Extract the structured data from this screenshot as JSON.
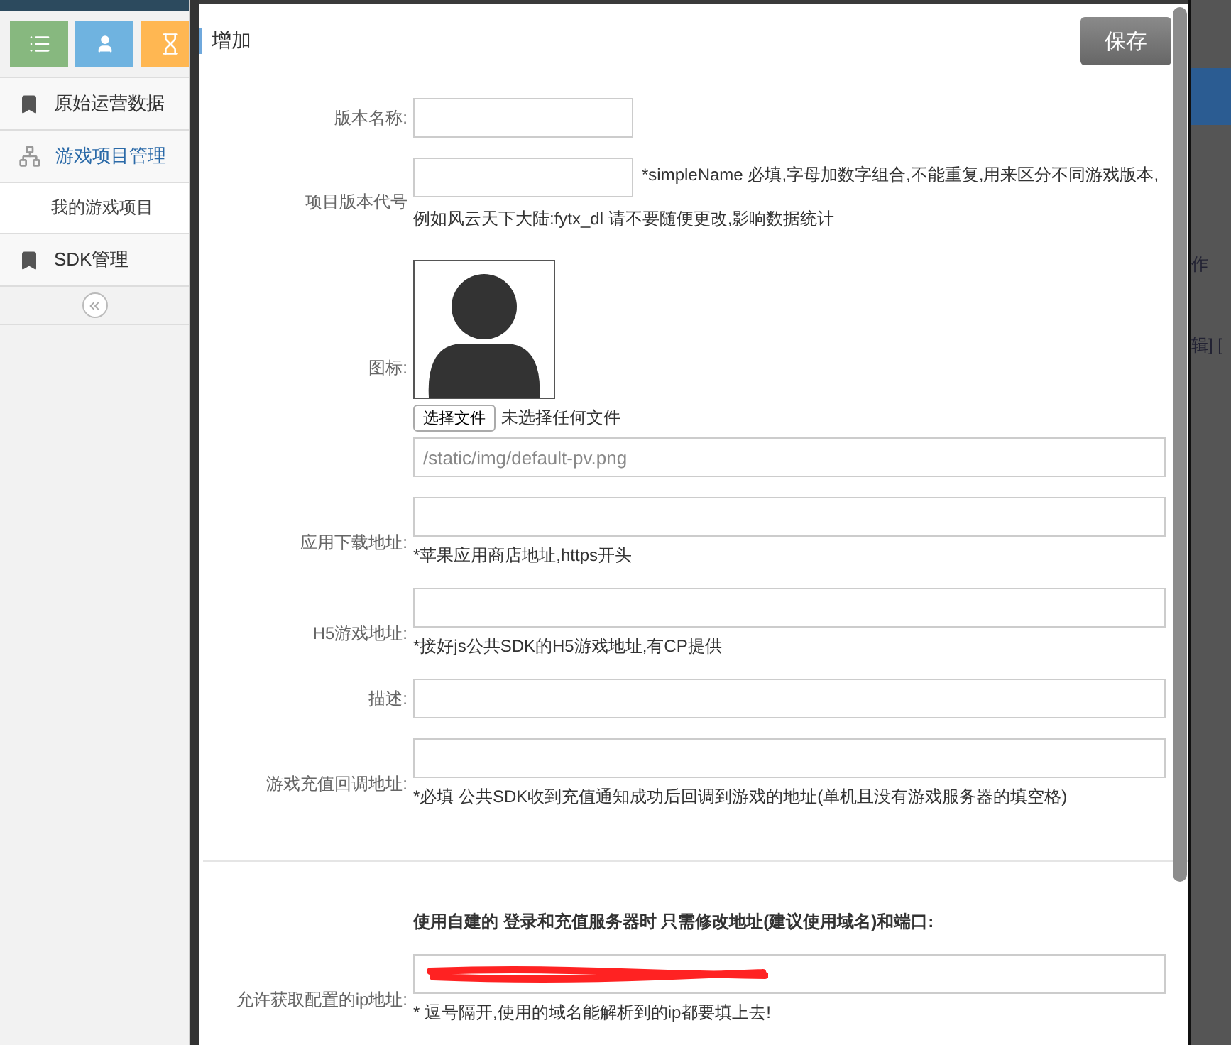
{
  "sidebar": {
    "shortcuts": [
      {
        "kind": "list",
        "color": "#87b87f"
      },
      {
        "kind": "user",
        "color": "#6fb3e0"
      },
      {
        "kind": "hourglass",
        "color": "#ffb752"
      }
    ],
    "menu": [
      {
        "label": "原始运营数据",
        "kind": "bookmark",
        "selected": false
      },
      {
        "label": "游戏项目管理",
        "kind": "sitemap",
        "selected": true,
        "children": [
          {
            "label": "我的游戏项目",
            "selected": false
          }
        ]
      },
      {
        "label": "SDK管理",
        "kind": "bookmark",
        "selected": false
      }
    ]
  },
  "dialog": {
    "title": "增加",
    "save_button": "保存",
    "fields": [
      {
        "kind": "short",
        "label": "版本名称:"
      },
      {
        "kind": "short",
        "label": "项目版本代号",
        "hint_lines": [
          "*simpleName 必填,字母加数字组合,不能重复,用来区分不同游戏版本,",
          "例如风云天下大陆:fytx_dl 请不要随便更改,影响数据统计"
        ]
      },
      {
        "kind": "image",
        "label": "图标:",
        "file_button": "选择文件",
        "file_status": "未选择任何文件",
        "value": "/static/img/default-pv.png"
      },
      {
        "kind": "wide",
        "label": "应用下载地址:",
        "hint": "*苹果应用商店地址,https开头"
      },
      {
        "kind": "wide",
        "label": "H5游戏地址:",
        "hint": "*接好js公共SDK的H5游戏地址,有CP提供"
      },
      {
        "kind": "wide",
        "label": "描述:"
      },
      {
        "kind": "wide",
        "label": "游戏充值回调地址:",
        "hint": "*必填 公共SDK收到充值通知成功后回调到游戏的地址(单机且没有游戏服务器的填空格)"
      }
    ],
    "section_note": "使用自建的 登录和充值服务器时 只需修改地址(建议使用域名)和端口:",
    "server_fields": [
      {
        "kind": "redacted",
        "label": "允许获取配置的ip地址:",
        "hint": "* 逗号隔开,使用的域名能解析到的ip都要填上去!"
      }
    ]
  },
  "background": {
    "texts": [
      "作",
      "辑] ["
    ]
  }
}
